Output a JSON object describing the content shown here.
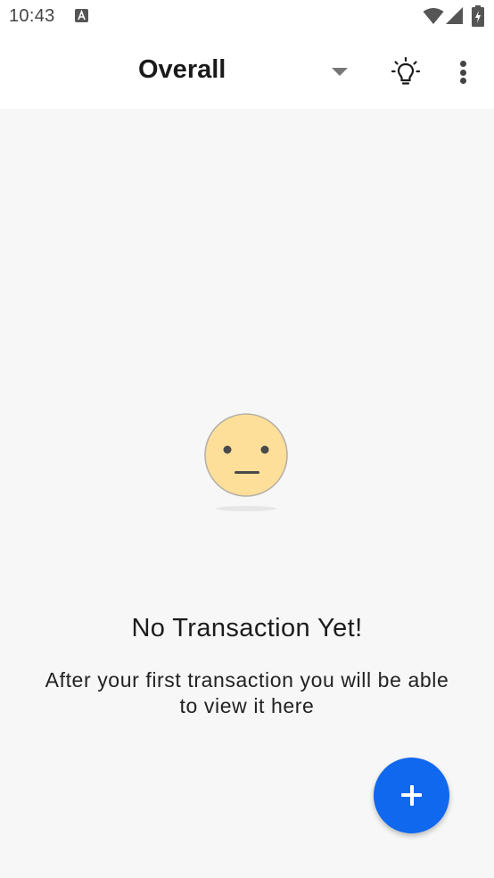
{
  "status_bar": {
    "time": "10:43",
    "icons": [
      "notification-a-icon",
      "wifi-icon",
      "cell-signal-icon",
      "battery-charging-icon"
    ]
  },
  "app_bar": {
    "title": "Overall",
    "icons": [
      "dropdown-caret-icon",
      "lightbulb-icon",
      "more-vert-icon"
    ]
  },
  "empty_state": {
    "illustration": "neutral-face-icon",
    "title": "No Transaction Yet!",
    "message": "After your first transaction you will be able to view it here"
  },
  "fab": {
    "icon": "plus-icon",
    "color": "#0f68ee"
  },
  "colors": {
    "accent": "#0f68ee",
    "face": "#fddf99",
    "background": "#f7f7f7"
  }
}
